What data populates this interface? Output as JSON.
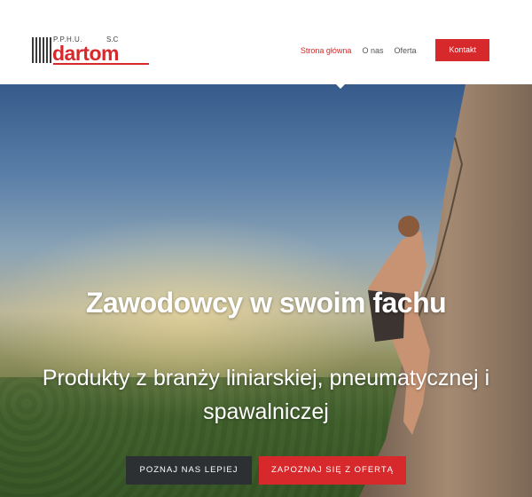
{
  "header": {
    "logo": {
      "small_left": "P.P.H.U.",
      "small_right": "S.C",
      "brand": "dartom"
    },
    "nav": [
      {
        "label": "Strona główna",
        "active": true
      },
      {
        "label": "O nas",
        "active": false
      },
      {
        "label": "Oferta",
        "active": false
      }
    ],
    "contact_button": "Kontakt"
  },
  "hero": {
    "title": "Zawodowcy w swoim fachu",
    "subtitle": "Produkty z branży liniarskiej, pneumatycznej i spawalniczej",
    "buttons": {
      "primary": "POZNAJ NAS LEPIEJ",
      "secondary": "ZAPOZNAJ SIĘ Z OFERTĄ"
    }
  },
  "colors": {
    "accent": "#d7282b",
    "dark_button": "#2d3033"
  }
}
